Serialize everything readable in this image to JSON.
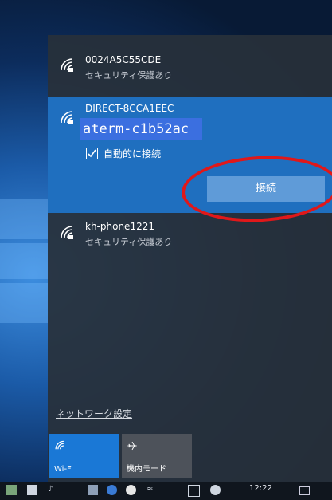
{
  "networks": [
    {
      "ssid": "0024A5C55CDE",
      "status": "セキュリティ保護あり",
      "icon": "wifi-secured-icon"
    },
    {
      "ssid": "DIRECT-8CCA1EEC",
      "password_value": "aterm-c1b52ac",
      "auto_connect_label": "自動的に接続",
      "auto_connect_checked": true,
      "connect_label": "接続",
      "icon": "wifi-secured-icon"
    },
    {
      "ssid": "kh-phone1221",
      "status": "セキュリティ保護あり",
      "icon": "wifi-secured-icon"
    }
  ],
  "network_settings_link": "ネットワーク設定",
  "quick_actions": [
    {
      "label": "Wi-Fi",
      "active": true,
      "icon": "wifi-icon"
    },
    {
      "label": "機内モード",
      "active": false,
      "icon": "airplane-icon"
    }
  ],
  "taskbar": {
    "time": "12:22"
  },
  "colors": {
    "accent": "#1f6fbf",
    "annotation": "#e0181a",
    "flyout_bg": "#28303a"
  }
}
